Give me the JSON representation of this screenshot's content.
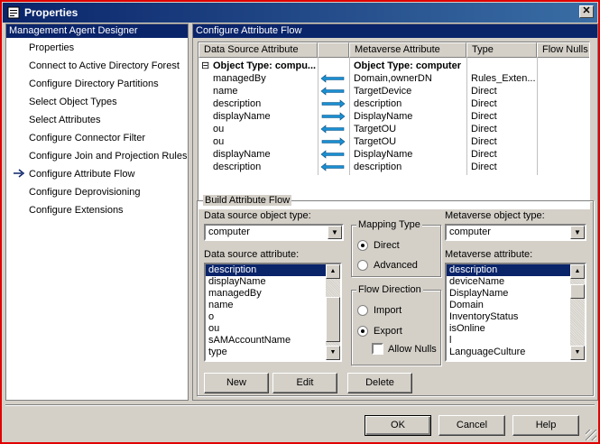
{
  "window": {
    "title": "Properties",
    "close_label": "✕"
  },
  "left_panel": {
    "header": "Management Agent Designer",
    "items": [
      {
        "label": "Properties",
        "active": false
      },
      {
        "label": "Connect to Active Directory Forest",
        "active": false
      },
      {
        "label": "Configure Directory Partitions",
        "active": false
      },
      {
        "label": "Select Object Types",
        "active": false
      },
      {
        "label": "Select Attributes",
        "active": false
      },
      {
        "label": "Configure Connector Filter",
        "active": false
      },
      {
        "label": "Configure Join and Projection Rules",
        "active": false
      },
      {
        "label": "Configure Attribute Flow",
        "active": true
      },
      {
        "label": "Configure Deprovisioning",
        "active": false
      },
      {
        "label": "Configure Extensions",
        "active": false
      }
    ]
  },
  "right_panel": {
    "header": "Configure Attribute Flow",
    "grid": {
      "columns": [
        "Data Source Attribute",
        "",
        "Metaverse Attribute",
        "Type",
        "Flow Nulls"
      ],
      "group_row": {
        "expander": "⊟",
        "source": "Object Type: compu...",
        "metaverse": "Object Type: computer"
      },
      "rows": [
        {
          "source": "managedBy",
          "direction": "import",
          "metaverse": "Domain,ownerDN",
          "type": "Rules_Exten..."
        },
        {
          "source": "name",
          "direction": "import",
          "metaverse": "TargetDevice",
          "type": "Direct"
        },
        {
          "source": "description",
          "direction": "export",
          "metaverse": "description",
          "type": "Direct"
        },
        {
          "source": "displayName",
          "direction": "export",
          "metaverse": "DisplayName",
          "type": "Direct"
        },
        {
          "source": "ou",
          "direction": "import",
          "metaverse": "TargetOU",
          "type": "Direct"
        },
        {
          "source": "ou",
          "direction": "export",
          "metaverse": "TargetOU",
          "type": "Direct"
        },
        {
          "source": "displayName",
          "direction": "import",
          "metaverse": "DisplayName",
          "type": "Direct"
        },
        {
          "source": "description",
          "direction": "import",
          "metaverse": "description",
          "type": "Direct"
        }
      ]
    },
    "build": {
      "label": "Build Attribute Flow",
      "ds_object_type_label": "Data source object type:",
      "ds_object_type_value": "computer",
      "ds_attribute_label": "Data source attribute:",
      "ds_attributes": [
        "description",
        "displayName",
        "managedBy",
        "name",
        "o",
        "ou",
        "sAMAccountName",
        "type"
      ],
      "mapping_type_label": "Mapping Type",
      "mapping_direct": "Direct",
      "mapping_advanced": "Advanced",
      "flow_direction_label": "Flow Direction",
      "flow_import": "Import",
      "flow_export": "Export",
      "allow_nulls": "Allow Nulls",
      "mv_object_type_label": "Metaverse object type:",
      "mv_object_type_value": "computer",
      "mv_attribute_label": "Metaverse attribute:",
      "mv_attributes": [
        "description",
        "deviceName",
        "DisplayName",
        "Domain",
        "InventoryStatus",
        "isOnline",
        "l",
        "LanguageCulture"
      ],
      "new_button": "New",
      "edit_button": "Edit",
      "delete_button": "Delete"
    }
  },
  "footer": {
    "ok": "OK",
    "cancel": "Cancel",
    "help": "Help"
  },
  "colors": {
    "frame": "#e00000",
    "title": "#0a246a",
    "face": "#d4d0c8",
    "arrow": "#1a8fd1"
  }
}
